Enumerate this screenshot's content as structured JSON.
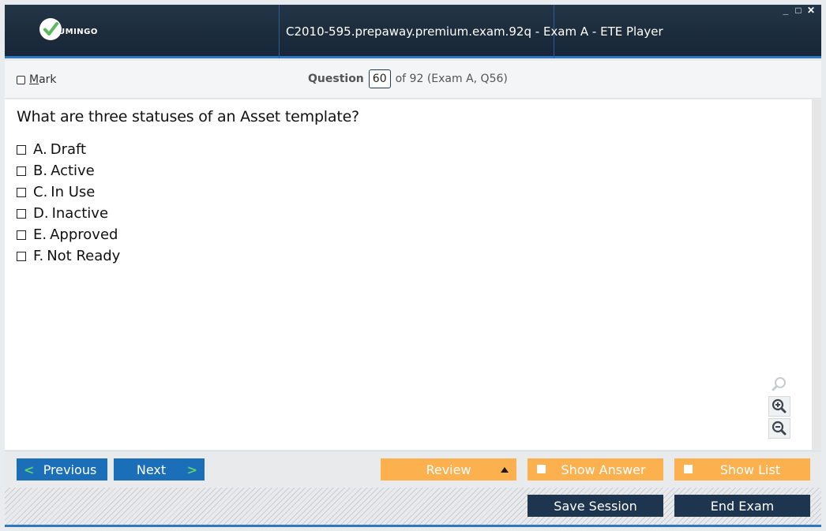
{
  "window": {
    "title": "C2010-595.prepaway.premium.exam.92q - Exam A - ETE Player",
    "brand_text": "UMINGO",
    "controls": {
      "minimize": "_",
      "maximize": "□",
      "close": "✕"
    }
  },
  "header": {
    "mark_label_underlined": "M",
    "mark_label_rest": "ark",
    "question_label": "Question",
    "question_number": "60",
    "question_of": "of 92 (Exam A, Q56)"
  },
  "question": {
    "text": "What are three statuses of an Asset template?",
    "options": [
      {
        "letter": "A.",
        "text": "Draft"
      },
      {
        "letter": "B.",
        "text": "Active"
      },
      {
        "letter": "C.",
        "text": "In Use"
      },
      {
        "letter": "D.",
        "text": "Inactive"
      },
      {
        "letter": "E.",
        "text": "Approved"
      },
      {
        "letter": "F.",
        "text": "Not Ready"
      }
    ]
  },
  "zoom": {
    "icons": [
      "search-icon",
      "zoom-in-icon",
      "zoom-out-icon"
    ]
  },
  "nav": {
    "previous_label": "Previous",
    "next_label": "Next",
    "review_label": "Review",
    "show_answer_label": "Show Answer",
    "show_list_label": "Show List"
  },
  "footer": {
    "save_session_label": "Save Session",
    "end_exam_label": "End Exam"
  },
  "colors": {
    "title_bar": "#1c2c3c",
    "accent_blue": "#1b6fb8",
    "accent_orange": "#fdb04e",
    "dark_button": "#1e3550",
    "logo_green": "#5cb85c"
  }
}
